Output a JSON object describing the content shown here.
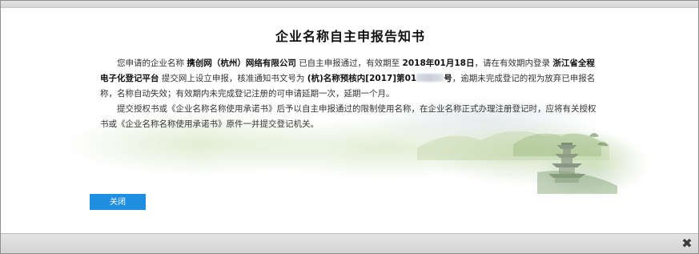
{
  "notice": {
    "title": "企业名称自主申报告知书",
    "p1_a": "您申请的企业名称",
    "company_name": "携创网（杭州）网络有限公司",
    "p1_b": "已自主申报通过，有效期至",
    "expiry_date": "2018年01月18日",
    "p1_c": "，请在有效期内登录",
    "platform_name": "浙江省全程电子化登记平台",
    "p1_d": "提交网上设立申报，核准通知书文号为",
    "doc_number_prefix": "(杭)名称预核内[2017]第01",
    "doc_number_suffix": "号",
    "p1_e": "，逾期未完成登记的视为放弃已申报名称，名称自动失效；有效期内未完成登记注册的可申请延期一次，延期一个月。",
    "p2": "提交授权书或《企业名称名称使用承诺书》后予以自主申报通过的限制使用名称，在企业名称正式办理注册登记时，应将有关授权书或《企业名称名称使用承诺书》原件一并提交登记机关。"
  },
  "actions": {
    "close_label": "关闭",
    "dialog_close_glyph": "✖"
  },
  "colors": {
    "accent": "#1e8ee0",
    "frame_border": "#8f8f8f",
    "bar_gray": "#d9d9d9"
  }
}
